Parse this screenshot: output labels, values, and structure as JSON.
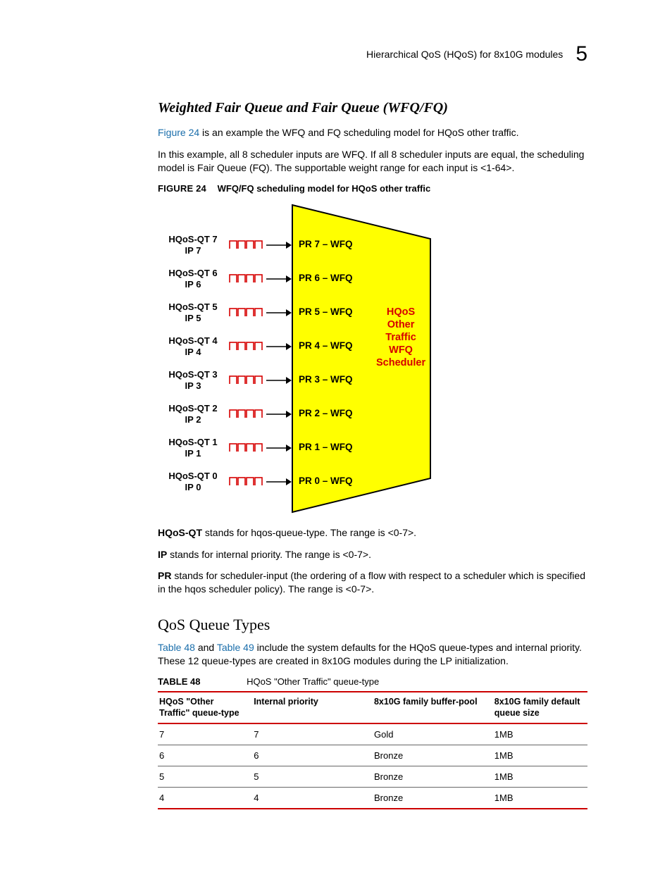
{
  "header": {
    "title": "Hierarchical QoS (HQoS) for 8x10G modules",
    "chapter": "5"
  },
  "s1": {
    "heading": "Weighted Fair Queue and Fair Queue (WFQ/FQ)",
    "p1_link": "Figure 24",
    "p1_rest": " is an example the WFQ and FQ scheduling model for HQoS other traffic.",
    "p2": "In this example, all 8 scheduler inputs are WFQ. If all 8 scheduler inputs are equal, the scheduling model is Fair Queue (FQ). The supportable weight range for each input is <1-64>.",
    "figcap_lbl": "FIGURE 24",
    "figcap_txt": "WFQ/FQ scheduling model for HQoS other traffic"
  },
  "chart_data": {
    "type": "table",
    "title": "WFQ/FQ scheduling model for HQoS other traffic",
    "scheduler_label": [
      "HQoS",
      "Other",
      "Traffic",
      "WFQ",
      "Scheduler"
    ],
    "rows": [
      {
        "qt": "HQoS-QT 7",
        "ip": "IP 7",
        "pr": "PR 7 – WFQ"
      },
      {
        "qt": "HQoS-QT 6",
        "ip": "IP 6",
        "pr": "PR 6 – WFQ"
      },
      {
        "qt": "HQoS-QT 5",
        "ip": "IP 5",
        "pr": "PR 5 – WFQ"
      },
      {
        "qt": "HQoS-QT 4",
        "ip": "IP 4",
        "pr": "PR 4 – WFQ"
      },
      {
        "qt": "HQoS-QT 3",
        "ip": "IP 3",
        "pr": "PR 3 – WFQ"
      },
      {
        "qt": "HQoS-QT 2",
        "ip": "IP 2",
        "pr": "PR 2 – WFQ"
      },
      {
        "qt": "HQoS-QT 1",
        "ip": "IP 1",
        "pr": "PR 1 – WFQ"
      },
      {
        "qt": "HQoS-QT 0",
        "ip": "IP 0",
        "pr": "PR 0 – WFQ"
      }
    ]
  },
  "notes": {
    "n1_b": "HQoS-QT",
    "n1": " stands for hqos-queue-type. The range is <0-7>.",
    "n2_b": "IP",
    "n2": " stands for internal priority. The range is <0-7>.",
    "n3_b": "PR",
    "n3": " stands for scheduler-input (the ordering of a flow with respect to a scheduler which is specified in the hqos scheduler policy). The range is <0-7>."
  },
  "s2": {
    "heading": "QoS Queue Types",
    "p1_l1": "Table 48",
    "p1_mid": " and ",
    "p1_l2": "Table 49",
    "p1_rest": " include the system defaults for the HQoS queue-types and internal priority. These 12 queue-types are created in 8x10G modules during the LP initialization.",
    "tblcap_lbl": "TABLE 48",
    "tblcap_txt": "HQoS \"Other Traffic\" queue-type"
  },
  "table48": {
    "headers": [
      "HQoS \"Other Traffic\" queue-type",
      "Internal priority",
      "8x10G family buffer-pool",
      "8x10G family default queue size"
    ],
    "rows": [
      [
        "7",
        "7",
        "Gold",
        "1MB"
      ],
      [
        "6",
        "6",
        "Bronze",
        "1MB"
      ],
      [
        "5",
        "5",
        "Bronze",
        "1MB"
      ],
      [
        "4",
        "4",
        "Bronze",
        "1MB"
      ]
    ]
  }
}
